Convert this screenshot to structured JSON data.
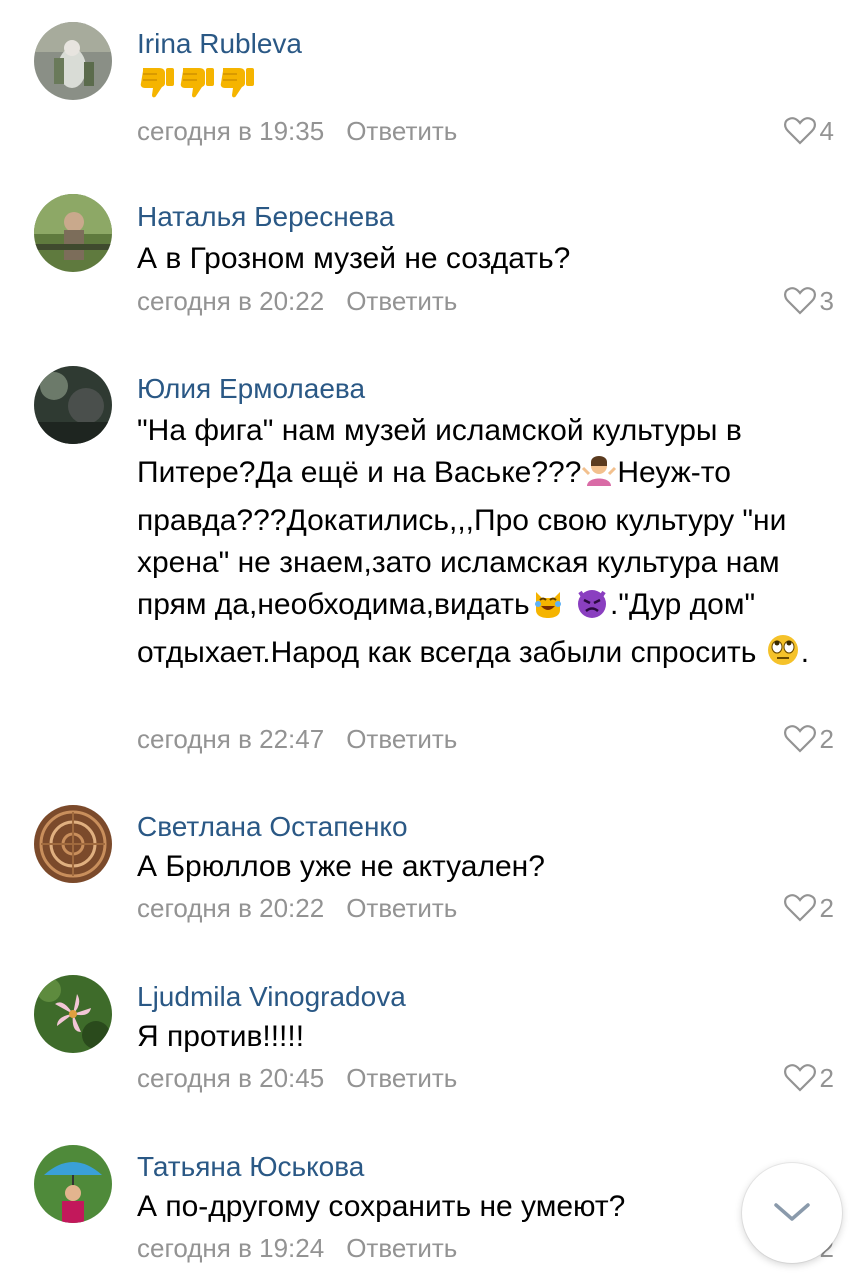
{
  "comments": [
    {
      "author": "Irina Rubleva",
      "text": "",
      "emojis": [
        "thumbs-down",
        "thumbs-down",
        "thumbs-down"
      ],
      "time": "сегодня в 19:35",
      "reply": "Ответить",
      "likes": "4"
    },
    {
      "author": "Наталья Береснева",
      "text": "А в Грозном музей не создать?",
      "time": "сегодня в 20:22",
      "reply": "Ответить",
      "likes": "3"
    },
    {
      "author": "Юлия Ермолаева",
      "text_parts": [
        "\"На фига\" нам музей исламской культуры в Питере?Да ещё и на Ваське???",
        "Неуж-то правда???Докатились,,,Про свою культуру \"ни хрена\" не знаем,зато исламская культура нам прям да,необходима,видать",
        ".\"Дур дом\" отдыхает.Народ как всегда забыли спросить",
        "."
      ],
      "emojis": [
        "shrug-emoji",
        "crying-laughing-cat-emoji",
        "angry-devil-emoji",
        "eye-roll-emoji"
      ],
      "time": "сегодня в 22:47",
      "reply": "Ответить",
      "likes": "2"
    },
    {
      "author": "Светлана Остапенко",
      "text": "А Брюллов уже не актуален?",
      "time": "сегодня в 20:22",
      "reply": "Ответить",
      "likes": "2"
    },
    {
      "author": "Ljudmila Vinogradova",
      "text": "Я против!!!!!",
      "time": "сегодня в 20:45",
      "reply": "Ответить",
      "likes": "2"
    },
    {
      "author": "Татьяна Юськова",
      "text": "А по-другому сохранить не умеют?",
      "time": "сегодня в 19:24",
      "reply": "Ответить",
      "likes": "2"
    }
  ],
  "colors": {
    "author": "#2a5885",
    "meta": "#939393",
    "text": "#000000"
  },
  "icons": {
    "like": "heart-outline-icon",
    "scroll": "chevron-down-icon"
  }
}
